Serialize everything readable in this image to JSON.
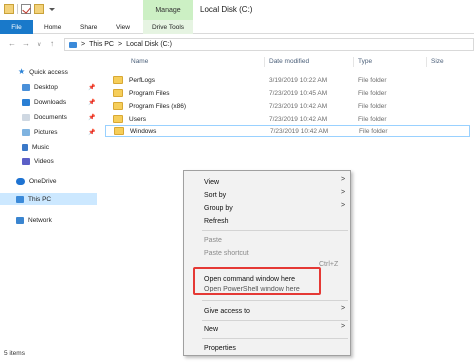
{
  "window": {
    "title": "Local Disk (C:)",
    "context_tab": "Manage"
  },
  "ribbon": {
    "tabs": [
      "File",
      "Home",
      "Share",
      "View",
      "Drive Tools"
    ]
  },
  "address": {
    "path": [
      "This PC",
      "Local Disk (C:)"
    ],
    "separator": ">"
  },
  "sidebar": {
    "items": [
      {
        "label": "Quick access"
      },
      {
        "label": "Desktop"
      },
      {
        "label": "Downloads"
      },
      {
        "label": "Documents"
      },
      {
        "label": "Pictures"
      },
      {
        "label": "Music"
      },
      {
        "label": "Videos"
      },
      {
        "label": "OneDrive"
      },
      {
        "label": "This PC"
      },
      {
        "label": "Network"
      }
    ]
  },
  "columns": {
    "name": "Name",
    "date": "Date modified",
    "type": "Type",
    "size": "Size"
  },
  "files": [
    {
      "name": "PerfLogs",
      "date": "3/19/2019 10:22 AM",
      "type": "File folder"
    },
    {
      "name": "Program Files",
      "date": "7/23/2019 10:45 AM",
      "type": "File folder"
    },
    {
      "name": "Program Files (x86)",
      "date": "7/23/2019 10:42 AM",
      "type": "File folder"
    },
    {
      "name": "Users",
      "date": "7/23/2019 10:42 AM",
      "type": "File folder"
    },
    {
      "name": "Windows",
      "date": "7/23/2019 10:42 AM",
      "type": "File folder"
    }
  ],
  "status": {
    "items": "5 items"
  },
  "context_menu": {
    "view": "View",
    "sort_by": "Sort by",
    "group_by": "Group by",
    "refresh": "Refresh",
    "paste": "Paste",
    "paste_shortcut": "Paste shortcut",
    "undo_shortcut": "Ctrl+Z",
    "open_cmd": "Open command window here",
    "open_ps": "Open PowerShell window here",
    "give_access": "Give access to",
    "new": "New",
    "properties": "Properties"
  },
  "colors": {
    "accent": "#1979ca",
    "highlight_box": "#e53935",
    "manage_tab": "#ccf0c4",
    "selection": "#cce8ff"
  }
}
